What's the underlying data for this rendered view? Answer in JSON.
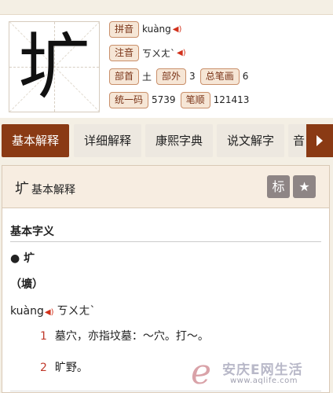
{
  "character": "圹",
  "info": {
    "pinyin_label": "拼音",
    "pinyin_value": "kuàng",
    "zhuyin_label": "注音",
    "zhuyin_value": "ㄎㄨㄤˋ",
    "radical_label": "部首",
    "radical_value": "土",
    "outer_label": "部外",
    "outer_value": "3",
    "total_label": "总笔画",
    "total_value": "6",
    "unicode_label": "统一码",
    "unicode_value": "5739",
    "order_label": "笔顺",
    "order_value": "121413"
  },
  "tabs": [
    "基本解释",
    "详细解释",
    "康熙字典",
    "说文解字",
    "音"
  ],
  "panel": {
    "title_char": "圹",
    "title_text": "基本解释",
    "btn_mark": "标",
    "btn_star": "★"
  },
  "section_title": "基本字义",
  "entry_head": "● 圹",
  "entry_trad": "（壙）",
  "entry_pinyin": "kuàng",
  "entry_zhuyin": "ㄎㄨㄤˋ",
  "definitions": [
    {
      "num": "1",
      "text": "墓穴，亦指坟墓：～穴。打～。"
    },
    {
      "num": "2",
      "text": "旷野。"
    }
  ],
  "watermark": {
    "logo": "e",
    "title": "安庆E网生活",
    "url": "www.aqlife.com"
  }
}
